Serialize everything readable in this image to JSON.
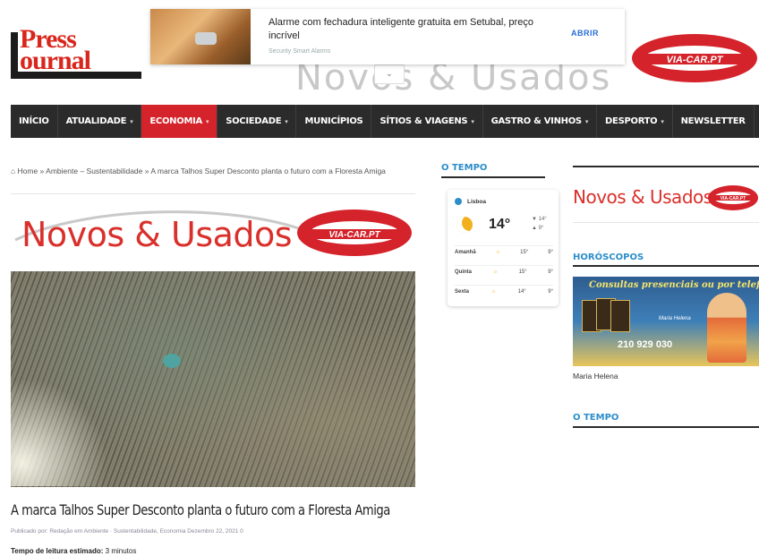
{
  "logo": {
    "line1": "Press",
    "line2": "ournal",
    "tagline": ""
  },
  "ad": {
    "title": "Alarme com fechadura inteligente gratuita em Setubal, preço incrível",
    "source": "Security Smart Alarms",
    "cta": "ABRIR"
  },
  "header": {
    "banner_text": "Novos & Usados",
    "viacar": "VIA-CAR.PT",
    "chevron": "⌄"
  },
  "nav": {
    "items": [
      {
        "label": "INÍCIO",
        "dropdown": false,
        "active": false
      },
      {
        "label": "ATUALIDADE",
        "dropdown": true,
        "active": false
      },
      {
        "label": "ECONOMIA",
        "dropdown": true,
        "active": true
      },
      {
        "label": "SOCIEDADE",
        "dropdown": true,
        "active": false
      },
      {
        "label": "MUNICÍPIOS",
        "dropdown": false,
        "active": false
      },
      {
        "label": "SÍTIOS & VIAGENS",
        "dropdown": true,
        "active": false
      },
      {
        "label": "GASTRO & VINHOS",
        "dropdown": true,
        "active": false
      },
      {
        "label": "DESPORTO",
        "dropdown": true,
        "active": false
      },
      {
        "label": "NEWSLETTER",
        "dropdown": false,
        "active": false
      }
    ],
    "dropdown_glyph": "▾"
  },
  "breadcrumb": {
    "home_icon": "home-icon",
    "text": "Home » Ambiente – Sustentabilidade » A marca Talhos Super Desconto planta o futuro com a Floresta Amiga"
  },
  "main_banner": {
    "text": "Novos & Usados",
    "viacar": "VIA-CAR.PT"
  },
  "article": {
    "title": "A marca Talhos Super Desconto planta o futuro com a Floresta Amiga",
    "meta": "Publicado por: Redação   em Ambiente · Sustentabilidade, Economia   Dezembro 22, 2021   0",
    "reading_label": "Tempo de leitura estimado:",
    "reading_value": "3 minutos"
  },
  "weather": {
    "title": "O TEMPO",
    "location": "Lisboa",
    "temp": "14°",
    "high": "14°",
    "low": "9°",
    "forecast": [
      {
        "day": "Amanhã",
        "hi": "15°",
        "lo": "9°"
      },
      {
        "day": "Quinta",
        "hi": "15°",
        "lo": "9°"
      },
      {
        "day": "Sexta",
        "hi": "14°",
        "lo": "9°"
      }
    ]
  },
  "sidebar": {
    "banner_text": "Novos & Usados",
    "viacar": "VIA-CAR.PT",
    "horoscope_title": "HORÓSCOPOS",
    "horoscope_ad": {
      "headline": "Consultas presenciais ou por telefone",
      "phone": "210 929 030",
      "signature": "Maria Helena"
    },
    "caption": "Maria Helena",
    "weather_title": "O TEMPO"
  },
  "colors": {
    "accent": "#d4232a",
    "nav_bg": "#2b2b2b",
    "link_blue": "#2c8dc9"
  }
}
